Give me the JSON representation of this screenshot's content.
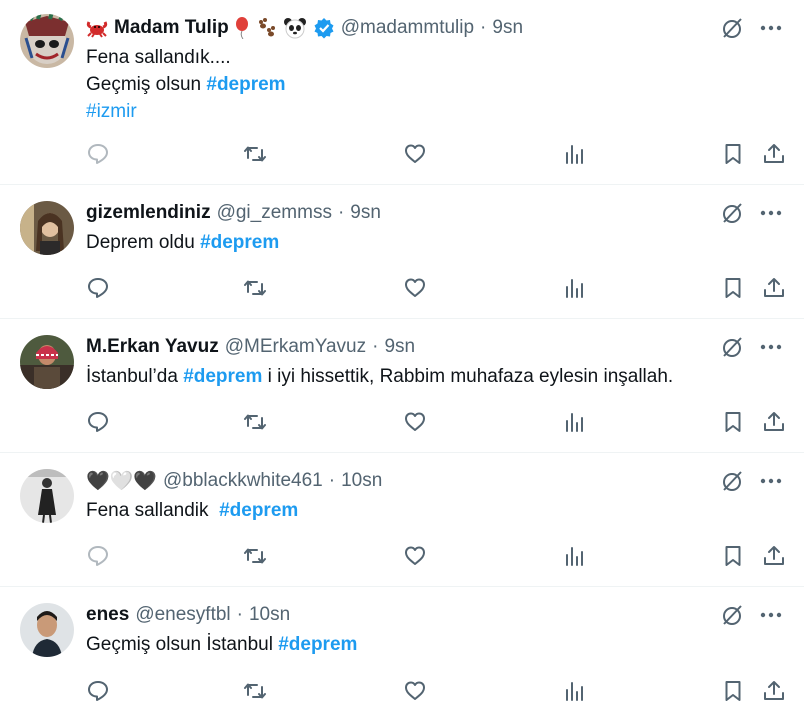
{
  "tweets": [
    {
      "name": "Madam Tulip",
      "handle": "@madammtulip",
      "dot": "·",
      "time": "9sn",
      "verified": true,
      "name_emojis": [
        "crab-emoji"
      ],
      "after_name_emojis": [
        "balloon-emoji",
        "paw-prints-emoji",
        "panda-emoji"
      ],
      "lines": [
        {
          "text": "Fena sallandık....",
          "hashtag": ""
        },
        {
          "text": "Geçmiş olsun ",
          "hashtag": "#deprem"
        },
        {
          "text": "",
          "hashtag": "#izmir"
        }
      ],
      "reply_muted": true
    },
    {
      "name": "gizemlendiniz",
      "handle": "@gi_zemmss",
      "dot": "·",
      "time": "9sn",
      "lines": [
        {
          "text": "Deprem oldu ",
          "hashtag": "#deprem"
        }
      ]
    },
    {
      "name": "M.Erkan Yavuz",
      "handle": "@MErkamYavuz",
      "dot": "·",
      "time": "9sn",
      "lines": [
        {
          "text": "İstanbul’da ",
          "hashtag": "#deprem",
          "suffix": " i iyi hissettik, Rabbim muhafaza eylesin inşallah."
        }
      ]
    },
    {
      "name": "🖤🤍🖤",
      "handle": "@bblackkwhite461",
      "dot": "·",
      "time": "10sn",
      "lines": [
        {
          "text": "Fena sallandik  ",
          "hashtag": "#deprem"
        }
      ],
      "reply_muted": true
    },
    {
      "name": "enes",
      "handle": "@enesyftbl",
      "dot": "·",
      "time": "10sn",
      "lines": [
        {
          "text": "Geçmiş olsun İstanbul ",
          "hashtag": "#deprem"
        }
      ]
    }
  ],
  "colors": {
    "text": "#0f1419",
    "secondary": "#536471",
    "accent": "#1d9bf0",
    "divider": "#eff3f4"
  },
  "icons": {
    "top": [
      "grok-icon",
      "more-icon"
    ],
    "actions": [
      "reply-icon",
      "retweet-icon",
      "like-icon",
      "views-icon",
      "bookmark-icon",
      "share-icon"
    ]
  }
}
